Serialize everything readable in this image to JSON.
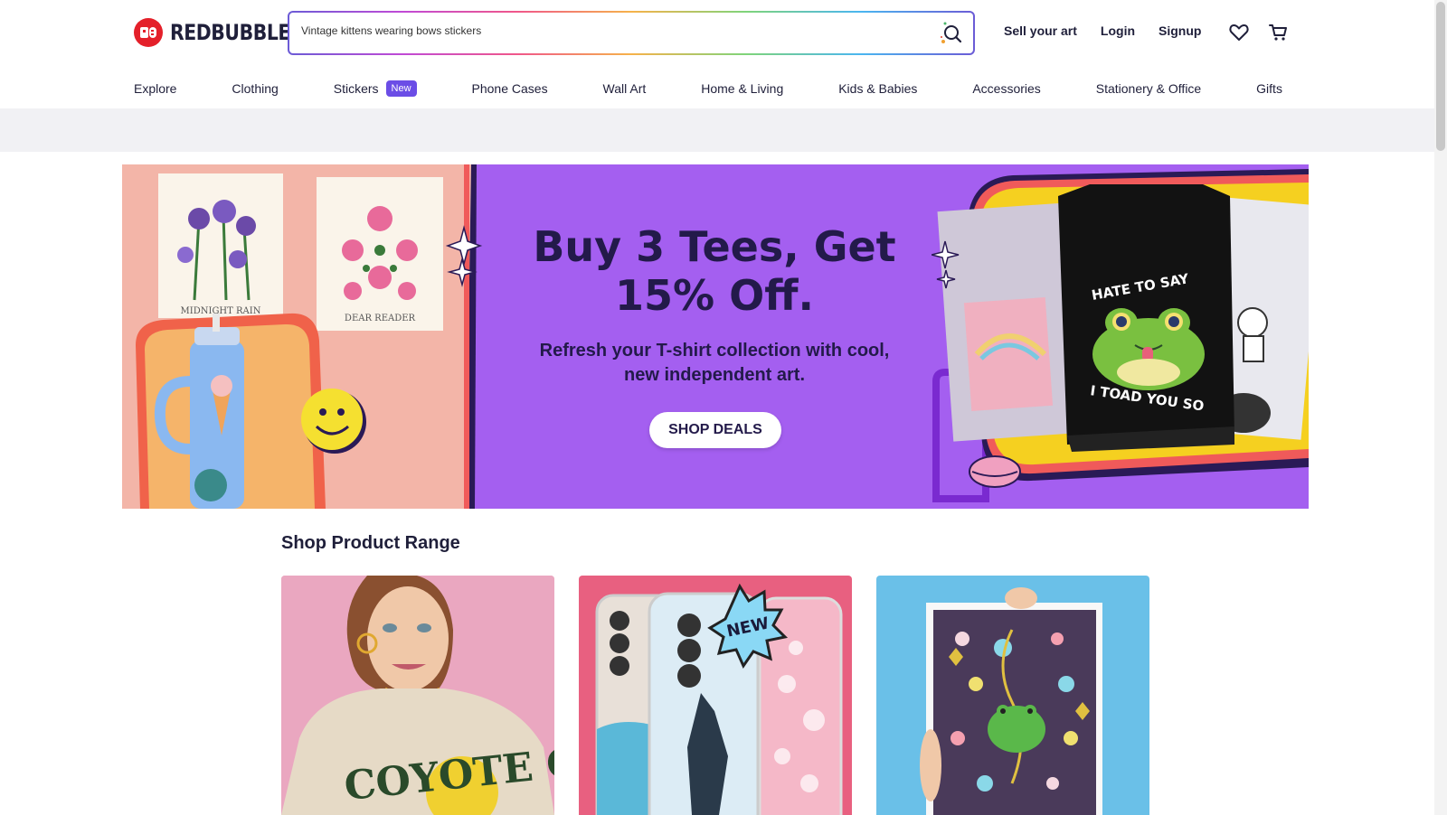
{
  "brand": {
    "name": "REDBUBBLE",
    "logo_color": "#e4202a"
  },
  "search": {
    "value": "Vintage kittens wearing bows stickers",
    "icon": "search-icon"
  },
  "header_links": {
    "sell": "Sell your art",
    "login": "Login",
    "signup": "Signup"
  },
  "header_icons": [
    "heart-icon",
    "cart-icon"
  ],
  "nav": {
    "items": [
      {
        "label": "Explore"
      },
      {
        "label": "Clothing"
      },
      {
        "label": "Stickers",
        "badge": "New"
      },
      {
        "label": "Phone Cases"
      },
      {
        "label": "Wall Art"
      },
      {
        "label": "Home & Living"
      },
      {
        "label": "Kids & Babies"
      },
      {
        "label": "Accessories"
      },
      {
        "label": "Stationery & Office"
      },
      {
        "label": "Gifts"
      }
    ]
  },
  "hero": {
    "title": "Buy 3 Tees, Get 15% Off.",
    "subtitle": "Refresh your T-shirt collection with cool, new independent art.",
    "cta": "SHOP DEALS",
    "bg_color": "#a45ff0",
    "art_left": {
      "print1": "MIDNIGHT RAIN",
      "print2": "DEAR READER"
    },
    "art_right": {
      "shirt_top": "HATE TO SAY",
      "shirt_bottom": "I TOAD YOU SO"
    }
  },
  "products": {
    "title": "Shop Product Range",
    "cards": [
      {
        "name": "clothing",
        "text": "COYOTE CUTIE"
      },
      {
        "name": "phone-cases",
        "badge": "NEW"
      },
      {
        "name": "wall-art"
      }
    ]
  },
  "colors": {
    "accent": "#6b4de6",
    "text": "#1f1f3a"
  }
}
